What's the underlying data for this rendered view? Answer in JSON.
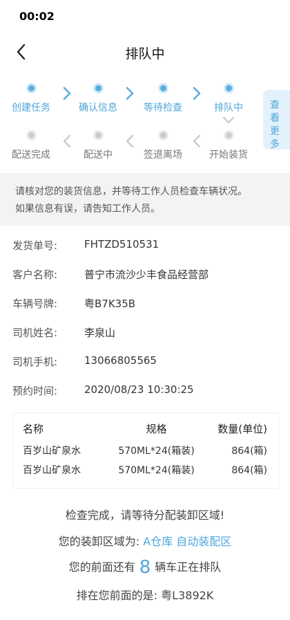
{
  "status_bar": {
    "time": "00:02"
  },
  "nav": {
    "title": "排队中"
  },
  "steps": {
    "row1": [
      {
        "label": "创建任务",
        "state": "active"
      },
      {
        "label": "确认信息",
        "state": "active"
      },
      {
        "label": "等待检查",
        "state": "active"
      },
      {
        "label": "排队中",
        "state": "active"
      }
    ],
    "row2": [
      {
        "label": "配送完成",
        "state": "inactive"
      },
      {
        "label": "配送中",
        "state": "inactive"
      },
      {
        "label": "签退离场",
        "state": "inactive"
      },
      {
        "label": "开始装货",
        "state": "inactive"
      }
    ]
  },
  "side_tab": {
    "label": "查看更多"
  },
  "notice": {
    "line1": "请核对您的装货信息，并等待工作人员检查车辆状况。",
    "line2": "如果信息有误，请告知工作人员。"
  },
  "info": [
    {
      "label": "发货单号:",
      "value": "FHTZD510531"
    },
    {
      "label": "客户名称:",
      "value": "普宁市流沙少丰食品经营部"
    },
    {
      "label": "车辆号牌:",
      "value": "粤B7K35B"
    },
    {
      "label": "司机姓名:",
      "value": "李泉山"
    },
    {
      "label": "司机手机:",
      "value": "13066805565"
    },
    {
      "label": "预约时间:",
      "value": "2020/08/23 10:30:25"
    }
  ],
  "goods_table": {
    "headers": [
      "名称",
      "规格",
      "数量(单位)"
    ],
    "rows": [
      [
        "百岁山矿泉水",
        "570ML*24(箱装)",
        "864(箱)"
      ],
      [
        "百岁山矿泉水",
        "570ML*24(箱装)",
        "864(箱)"
      ]
    ]
  },
  "summary": {
    "check_done": "检查完成，请等待分配装卸区域!",
    "area_prefix": "您的装卸区域为:",
    "area_value": "A仓库 自动装配区",
    "queue_prefix": "您的前面还有",
    "queue_count": "8",
    "queue_suffix": "辆车正在排队",
    "ahead_prefix": "排在您前面的是:",
    "ahead_plate": "粤L3892K"
  },
  "colors": {
    "accent": "#4fa6da",
    "inactive": "#cccccc",
    "notice_bg": "#f3f3f3"
  }
}
